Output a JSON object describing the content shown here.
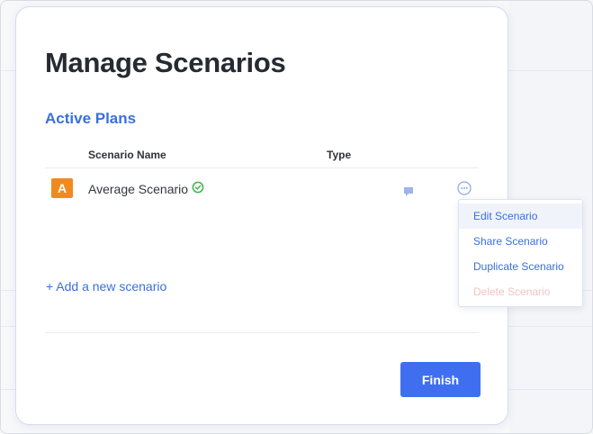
{
  "modal": {
    "title": "Manage Scenarios",
    "section_title": "Active Plans",
    "table": {
      "columns": [
        "Scenario Name",
        "Type"
      ],
      "rows": [
        {
          "avatar_letter": "A",
          "name": "Average Scenario",
          "status_icon": "check-circle-icon",
          "type_icon": "comment-icon",
          "actions_icon": "more-horizontal-icon"
        }
      ]
    },
    "add_link": "+ Add a new scenario",
    "finish_label": "Finish"
  },
  "menu": {
    "items": [
      "Edit Scenario",
      "Share Scenario",
      "Duplicate Scenario",
      "Delete Scenario"
    ]
  },
  "colors": {
    "accent": "#3a6fe0",
    "button": "#3f6ff0",
    "avatar": "#f08a1e",
    "success": "#3bb54a",
    "danger_disabled": "#f3c3c3"
  }
}
